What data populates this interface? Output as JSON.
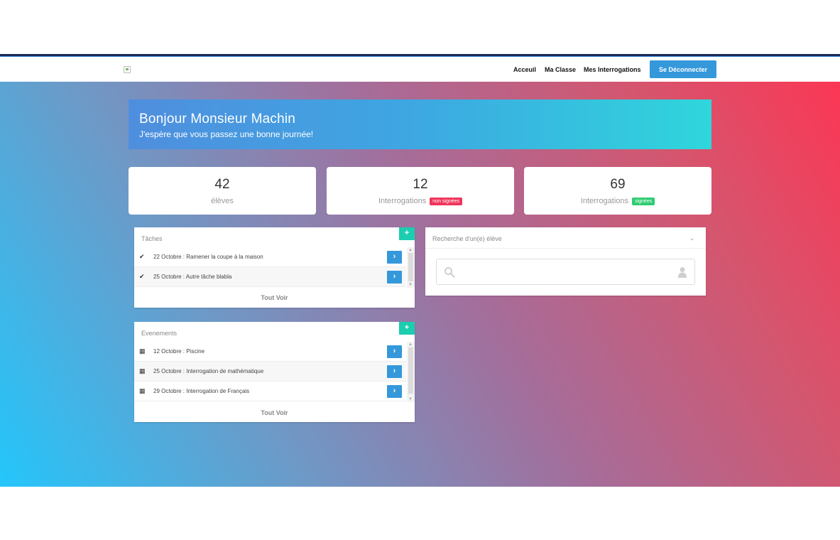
{
  "nav": {
    "links": [
      "Acceuil",
      "Ma Classe",
      "Mes Interrogations"
    ],
    "logout_label": "Se Déconnecter"
  },
  "banner": {
    "title": "Bonjour Monsieur Machin",
    "subtitle": "J'espère que vous passez une bonne journée!"
  },
  "stats": [
    {
      "value": "42",
      "label": "élèves",
      "badge": ""
    },
    {
      "value": "12",
      "label": "Interrogations",
      "badge": "non signées"
    },
    {
      "value": "69",
      "label": "Interrogations",
      "badge": "signées"
    }
  ],
  "tasks": {
    "title": "Tâches",
    "add_label": "+",
    "items": [
      {
        "text": "22 Octobre : Ramener la coupe à la maison",
        "icon": "check-icon"
      },
      {
        "text": "25 Octobre : Autre tâche blabla",
        "icon": "check-icon"
      }
    ],
    "see_all": "Tout Voir"
  },
  "events": {
    "title": "Evenements",
    "add_label": "+",
    "items": [
      {
        "text": "12 Octobre : Piscine",
        "icon": "calendar-icon"
      },
      {
        "text": "25 Octobre : Interrogation de mathématique",
        "icon": "calendar-icon"
      },
      {
        "text": "29 Octobre : Interrogation de Français",
        "icon": "calendar-icon"
      }
    ],
    "see_all": "Tout Voir"
  },
  "search": {
    "title": "Recherche d'un(e) élève",
    "placeholder": ""
  },
  "colors": {
    "accent_blue": "#3498db",
    "accent_teal": "#1ccdb0",
    "badge_red": "#f0355b",
    "badge_green": "#2fcc71",
    "gradient_left": "#24c6fb",
    "gradient_right": "#fb3755"
  }
}
